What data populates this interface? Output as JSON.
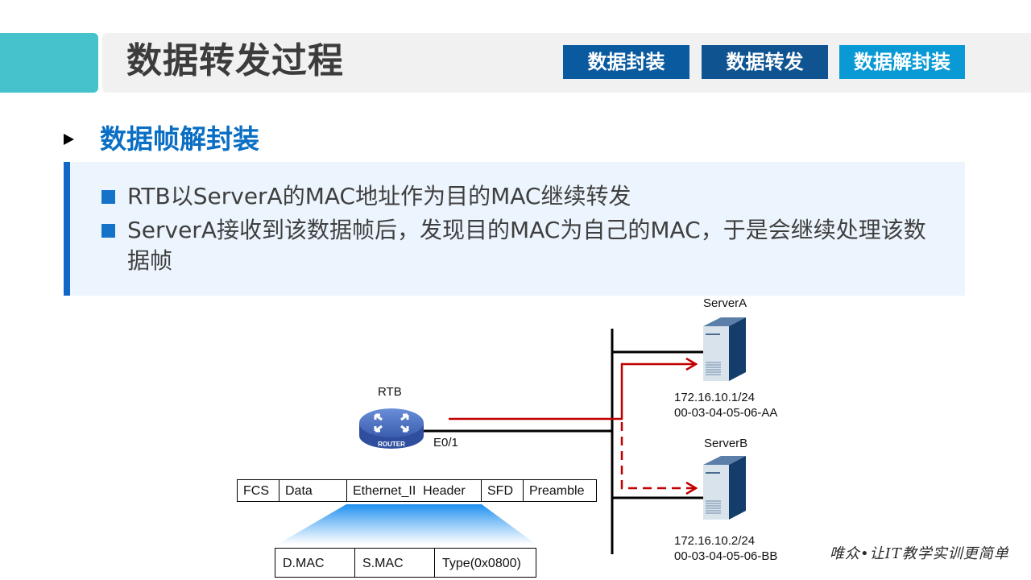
{
  "header": {
    "title": "数据转发过程",
    "tabs": [
      {
        "label": "数据封装",
        "color": "#0a5aa0"
      },
      {
        "label": "数据转发",
        "color": "#0f5391"
      },
      {
        "label": "数据解封装",
        "color": "#099ad6",
        "active": true
      }
    ]
  },
  "section": {
    "title": "数据帧解封装",
    "bullets": [
      "RTB以ServerA的MAC地址作为目的MAC继续转发",
      "ServerA接收到该数据帧后，发现目的MAC为自己的MAC，于是会继续处理该数据帧"
    ]
  },
  "diagram": {
    "router": {
      "name": "RTB",
      "icon": "router-icon",
      "icon_label": "ROUTER",
      "interface": "E0/1"
    },
    "servers": [
      {
        "name": "ServerA",
        "icon": "server-icon",
        "ip": "172.16.10.1/24",
        "mac": "00-03-04-05-06-AA",
        "path": "solid"
      },
      {
        "name": "ServerB",
        "icon": "server-icon",
        "ip": "172.16.10.2/24",
        "mac": "00-03-04-05-06-BB",
        "path": "dashed"
      }
    ],
    "frame_fields": [
      "FCS",
      "Data",
      "Ethernet_II  Header",
      "SFD",
      "Preamble"
    ],
    "header_fields": [
      "D.MAC",
      "S.MAC",
      "Type(0x0800)"
    ],
    "colors": {
      "path": "#c00000",
      "accent": "#45c2cc"
    }
  },
  "footer": {
    "slogan": "唯众•让IT教学实训更简单"
  }
}
